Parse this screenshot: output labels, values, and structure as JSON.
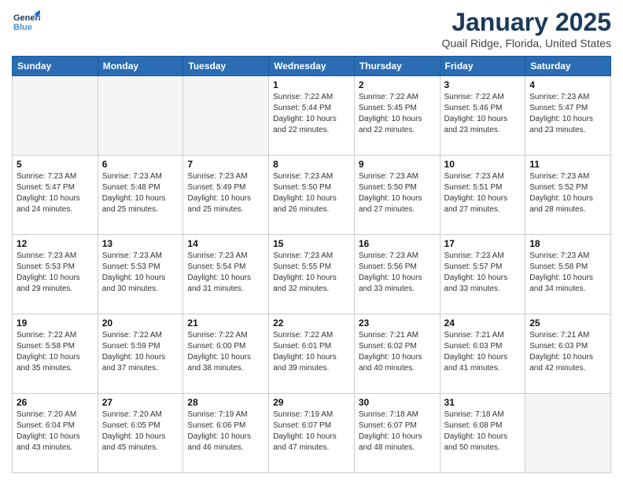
{
  "header": {
    "logo_line1": "General",
    "logo_line2": "Blue",
    "title": "January 2025",
    "subtitle": "Quail Ridge, Florida, United States"
  },
  "days_of_week": [
    "Sunday",
    "Monday",
    "Tuesday",
    "Wednesday",
    "Thursday",
    "Friday",
    "Saturday"
  ],
  "weeks": [
    [
      {
        "day": "",
        "info": ""
      },
      {
        "day": "",
        "info": ""
      },
      {
        "day": "",
        "info": ""
      },
      {
        "day": "1",
        "info": "Sunrise: 7:22 AM\nSunset: 5:44 PM\nDaylight: 10 hours\nand 22 minutes."
      },
      {
        "day": "2",
        "info": "Sunrise: 7:22 AM\nSunset: 5:45 PM\nDaylight: 10 hours\nand 22 minutes."
      },
      {
        "day": "3",
        "info": "Sunrise: 7:22 AM\nSunset: 5:46 PM\nDaylight: 10 hours\nand 23 minutes."
      },
      {
        "day": "4",
        "info": "Sunrise: 7:23 AM\nSunset: 5:47 PM\nDaylight: 10 hours\nand 23 minutes."
      }
    ],
    [
      {
        "day": "5",
        "info": "Sunrise: 7:23 AM\nSunset: 5:47 PM\nDaylight: 10 hours\nand 24 minutes."
      },
      {
        "day": "6",
        "info": "Sunrise: 7:23 AM\nSunset: 5:48 PM\nDaylight: 10 hours\nand 25 minutes."
      },
      {
        "day": "7",
        "info": "Sunrise: 7:23 AM\nSunset: 5:49 PM\nDaylight: 10 hours\nand 25 minutes."
      },
      {
        "day": "8",
        "info": "Sunrise: 7:23 AM\nSunset: 5:50 PM\nDaylight: 10 hours\nand 26 minutes."
      },
      {
        "day": "9",
        "info": "Sunrise: 7:23 AM\nSunset: 5:50 PM\nDaylight: 10 hours\nand 27 minutes."
      },
      {
        "day": "10",
        "info": "Sunrise: 7:23 AM\nSunset: 5:51 PM\nDaylight: 10 hours\nand 27 minutes."
      },
      {
        "day": "11",
        "info": "Sunrise: 7:23 AM\nSunset: 5:52 PM\nDaylight: 10 hours\nand 28 minutes."
      }
    ],
    [
      {
        "day": "12",
        "info": "Sunrise: 7:23 AM\nSunset: 5:53 PM\nDaylight: 10 hours\nand 29 minutes."
      },
      {
        "day": "13",
        "info": "Sunrise: 7:23 AM\nSunset: 5:53 PM\nDaylight: 10 hours\nand 30 minutes."
      },
      {
        "day": "14",
        "info": "Sunrise: 7:23 AM\nSunset: 5:54 PM\nDaylight: 10 hours\nand 31 minutes."
      },
      {
        "day": "15",
        "info": "Sunrise: 7:23 AM\nSunset: 5:55 PM\nDaylight: 10 hours\nand 32 minutes."
      },
      {
        "day": "16",
        "info": "Sunrise: 7:23 AM\nSunset: 5:56 PM\nDaylight: 10 hours\nand 33 minutes."
      },
      {
        "day": "17",
        "info": "Sunrise: 7:23 AM\nSunset: 5:57 PM\nDaylight: 10 hours\nand 33 minutes."
      },
      {
        "day": "18",
        "info": "Sunrise: 7:23 AM\nSunset: 5:58 PM\nDaylight: 10 hours\nand 34 minutes."
      }
    ],
    [
      {
        "day": "19",
        "info": "Sunrise: 7:22 AM\nSunset: 5:58 PM\nDaylight: 10 hours\nand 35 minutes."
      },
      {
        "day": "20",
        "info": "Sunrise: 7:22 AM\nSunset: 5:59 PM\nDaylight: 10 hours\nand 37 minutes."
      },
      {
        "day": "21",
        "info": "Sunrise: 7:22 AM\nSunset: 6:00 PM\nDaylight: 10 hours\nand 38 minutes."
      },
      {
        "day": "22",
        "info": "Sunrise: 7:22 AM\nSunset: 6:01 PM\nDaylight: 10 hours\nand 39 minutes."
      },
      {
        "day": "23",
        "info": "Sunrise: 7:21 AM\nSunset: 6:02 PM\nDaylight: 10 hours\nand 40 minutes."
      },
      {
        "day": "24",
        "info": "Sunrise: 7:21 AM\nSunset: 6:03 PM\nDaylight: 10 hours\nand 41 minutes."
      },
      {
        "day": "25",
        "info": "Sunrise: 7:21 AM\nSunset: 6:03 PM\nDaylight: 10 hours\nand 42 minutes."
      }
    ],
    [
      {
        "day": "26",
        "info": "Sunrise: 7:20 AM\nSunset: 6:04 PM\nDaylight: 10 hours\nand 43 minutes."
      },
      {
        "day": "27",
        "info": "Sunrise: 7:20 AM\nSunset: 6:05 PM\nDaylight: 10 hours\nand 45 minutes."
      },
      {
        "day": "28",
        "info": "Sunrise: 7:19 AM\nSunset: 6:06 PM\nDaylight: 10 hours\nand 46 minutes."
      },
      {
        "day": "29",
        "info": "Sunrise: 7:19 AM\nSunset: 6:07 PM\nDaylight: 10 hours\nand 47 minutes."
      },
      {
        "day": "30",
        "info": "Sunrise: 7:18 AM\nSunset: 6:07 PM\nDaylight: 10 hours\nand 48 minutes."
      },
      {
        "day": "31",
        "info": "Sunrise: 7:18 AM\nSunset: 6:08 PM\nDaylight: 10 hours\nand 50 minutes."
      },
      {
        "day": "",
        "info": ""
      }
    ]
  ]
}
